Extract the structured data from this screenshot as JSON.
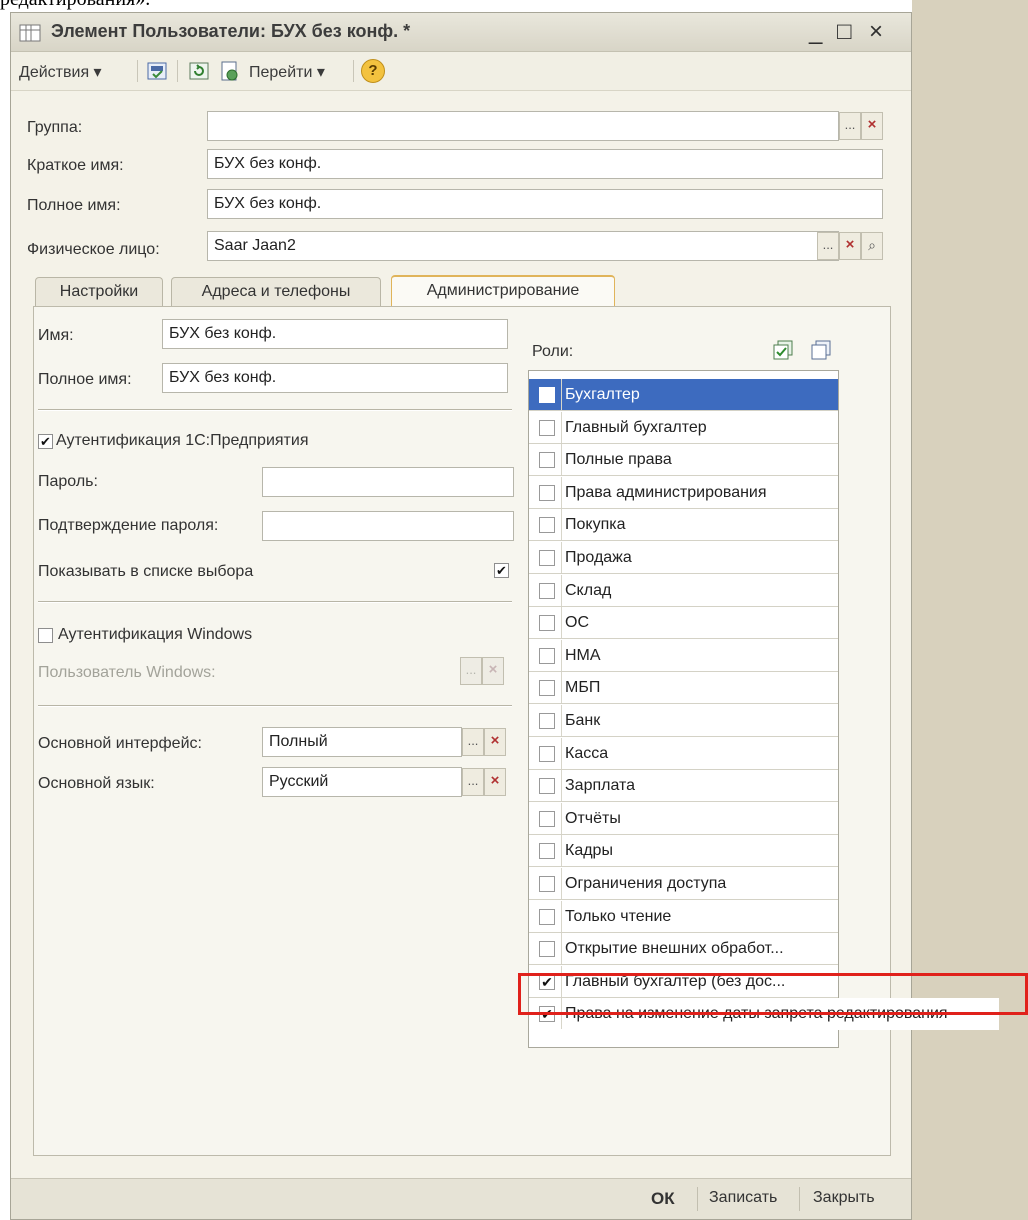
{
  "top_text": "редактирования».",
  "window": {
    "title": "Элемент Пользователи: БУХ без конф. *",
    "minimize": "_",
    "maximize": "□",
    "close": "×"
  },
  "toolbar": {
    "actions_label": "Действия ▾",
    "goto_label": "Перейти ▾",
    "help_icon": "?"
  },
  "header_fields": {
    "group_label": "Группа:",
    "group_value": "",
    "short_name_label": "Краткое имя:",
    "short_name_value": "БУХ без конф.",
    "full_name_label": "Полное имя:",
    "full_name_value": "БУХ без конф.",
    "person_label": "Физическое лицо:",
    "person_value": "Saar Jaan2"
  },
  "tabs": [
    {
      "label": "Настройки"
    },
    {
      "label": "Адреса и телефоны"
    },
    {
      "label": "Администрирование"
    }
  ],
  "admin": {
    "name_label": "Имя:",
    "name_value": "БУХ без конф.",
    "full_name_label": "Полное имя:",
    "full_name_value": "БУХ без конф.",
    "auth_1c_label": "Аутентификация 1С:Предприятия",
    "auth_1c_checked": true,
    "password_label": "Пароль:",
    "password_confirm_label": "Подтверждение пароля:",
    "show_in_list_label": "Показывать в списке выбора",
    "show_in_list_checked": true,
    "auth_windows_label": "Аутентификация Windows",
    "auth_windows_checked": false,
    "windows_user_label": "Пользователь Windows:",
    "main_interface_label": "Основной интерфейс:",
    "main_interface_value": "Полный",
    "main_language_label": "Основной язык:",
    "main_language_value": "Русский",
    "roles_label": "Роли:"
  },
  "roles": [
    {
      "label": "Бухгалтер",
      "checked": false,
      "selected": true
    },
    {
      "label": "Главный бухгалтер",
      "checked": false
    },
    {
      "label": "Полные права",
      "checked": false
    },
    {
      "label": "Права администрирования",
      "checked": false
    },
    {
      "label": "Покупка",
      "checked": false
    },
    {
      "label": "Продажа",
      "checked": false
    },
    {
      "label": "Склад",
      "checked": false
    },
    {
      "label": "ОС",
      "checked": false
    },
    {
      "label": "НМА",
      "checked": false
    },
    {
      "label": "МБП",
      "checked": false
    },
    {
      "label": "Банк",
      "checked": false
    },
    {
      "label": "Касса",
      "checked": false
    },
    {
      "label": "Зарплата",
      "checked": false
    },
    {
      "label": "Отчёты",
      "checked": false
    },
    {
      "label": "Кадры",
      "checked": false
    },
    {
      "label": "Ограничения доступа",
      "checked": false
    },
    {
      "label": "Только чтение",
      "checked": false
    },
    {
      "label": "Открытие внешних обработ...",
      "checked": false
    },
    {
      "label": "Главный бухгалтер (без дос...",
      "checked": true
    },
    {
      "label": "Права на изменение даты запрета редактирования",
      "checked": true,
      "highlighted": true
    }
  ],
  "footer": {
    "ok_label": "ОК",
    "save_label": "Записать",
    "close_label": "Закрыть"
  },
  "colors": {
    "selection": "#3d6bbf",
    "highlight_frame": "#e0211b",
    "side_panel": "#d8d1bd"
  }
}
